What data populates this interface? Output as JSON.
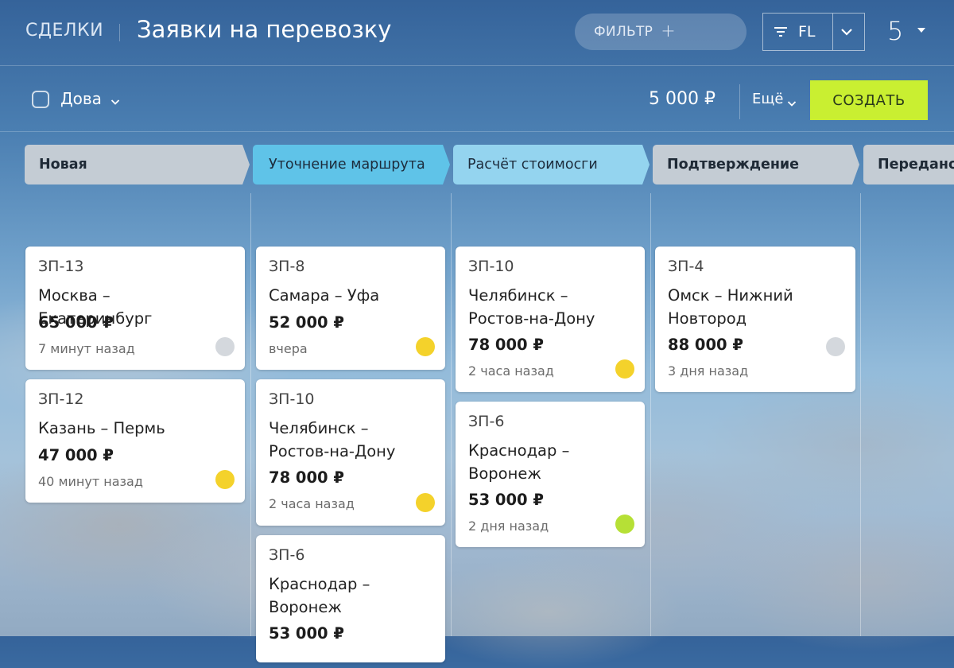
{
  "colors": {
    "accent_green": "#c9ef31",
    "stage_gray": "#c4ccd4",
    "stage_blue": "#5fc3e8",
    "stage_lightblue": "#94d4ef",
    "dot_gray": "#d4d8dd",
    "dot_yellow": "#f4d22b",
    "dot_green": "#b6e036"
  },
  "header": {
    "section": "СДЕЛКИ",
    "title": "Заявки на перевозку",
    "filter_label": "ФИЛЬТР",
    "filter_icon": "plus-icon",
    "filter_mode": "FL",
    "count": "5"
  },
  "toolbar": {
    "owner": "Дова",
    "total": "5 000 ₽",
    "more": "Ещё",
    "create": "СОЗДАТЬ"
  },
  "stages": [
    "Новая",
    "Уточнение маршрута",
    "Расчёт стоимосги",
    "Подтверждение",
    "Передано"
  ],
  "columns": [
    {
      "cards": [
        {
          "id": "ЗП-13",
          "route": "Москва – Екатеринбург",
          "price": "65 000 ₽",
          "time": "7 минут назад",
          "status": "gray"
        },
        {
          "id": "ЗП-12",
          "route": "Казань – Пермь",
          "price": "47 000 ₽",
          "time": "40 минут назад",
          "status": "yellow"
        }
      ]
    },
    {
      "cards": [
        {
          "id": "ЗП-8",
          "route": "Самара – Уфа",
          "price": "52 000 ₽",
          "time": "вчера",
          "status": "yellow"
        },
        {
          "id": "ЗП-10",
          "route": "Челябинск – Ростов-на-Дону",
          "price": "78 000 ₽",
          "time": "2 часа назад",
          "status": "yellow"
        },
        {
          "id": "ЗП-6",
          "route": "Краснодар – Воронеж",
          "price": "53 000 ₽",
          "time": "",
          "status": ""
        }
      ]
    },
    {
      "cards": [
        {
          "id": "ЗП-10",
          "route": "Челябинск – Ростов-на-Дону",
          "price": "78 000 ₽",
          "time": "2 часа назад",
          "status": "yellow"
        },
        {
          "id": "ЗП-6",
          "route": "Краснодар – Воронеж",
          "price": "53 000 ₽",
          "time": "2 дня назад",
          "status": "green"
        }
      ]
    },
    {
      "cards": [
        {
          "id": "ЗП-4",
          "route": "Омск – Нижний Новтород",
          "price": "88 000 ₽",
          "time": "3 дня назад",
          "status": "gray"
        }
      ]
    }
  ]
}
